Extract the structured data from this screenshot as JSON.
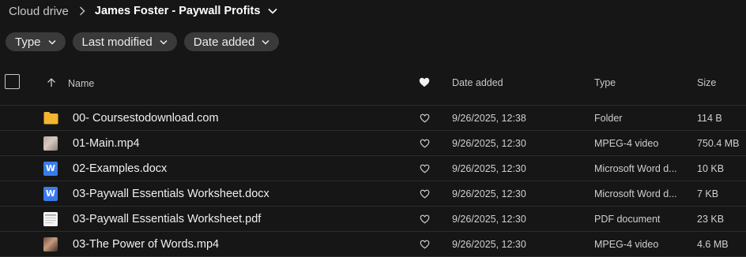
{
  "breadcrumb": {
    "root": "Cloud drive",
    "current": "James Foster - Paywall Profits"
  },
  "filters": [
    {
      "label": "Type"
    },
    {
      "label": "Last modified"
    },
    {
      "label": "Date added"
    }
  ],
  "columns": {
    "name": "Name",
    "date_added": "Date added",
    "type": "Type",
    "size": "Size"
  },
  "rows": [
    {
      "name": "00- Coursestodownload.com",
      "date": "9/26/2025, 12:38",
      "type": "Folder",
      "size": "114 B",
      "icon": "folder-icon"
    },
    {
      "name": "01-Main.mp4",
      "date": "9/26/2025, 12:30",
      "type": "MPEG-4 video",
      "size": "750.4 MB",
      "icon": "video-thumbnail-icon"
    },
    {
      "name": "02-Examples.docx",
      "date": "9/26/2025, 12:30",
      "type": "Microsoft Word d...",
      "size": "10 KB",
      "icon": "word-doc-icon"
    },
    {
      "name": "03-Paywall Essentials Worksheet.docx",
      "date": "9/26/2025, 12:30",
      "type": "Microsoft Word d...",
      "size": "7 KB",
      "icon": "word-doc-icon"
    },
    {
      "name": "03-Paywall Essentials Worksheet.pdf",
      "date": "9/26/2025, 12:30",
      "type": "PDF document",
      "size": "23 KB",
      "icon": "pdf-doc-icon"
    },
    {
      "name": "03-The Power of Words.mp4",
      "date": "9/26/2025, 12:30",
      "type": "MPEG-4 video",
      "size": "4.6 MB",
      "icon": "video-thumbnail-icon"
    }
  ],
  "word_icon_letter": "W",
  "colors": {
    "background": "#161616",
    "chip": "#3a3a3a",
    "folder": "#f5b52e",
    "word": "#3a7bea"
  }
}
